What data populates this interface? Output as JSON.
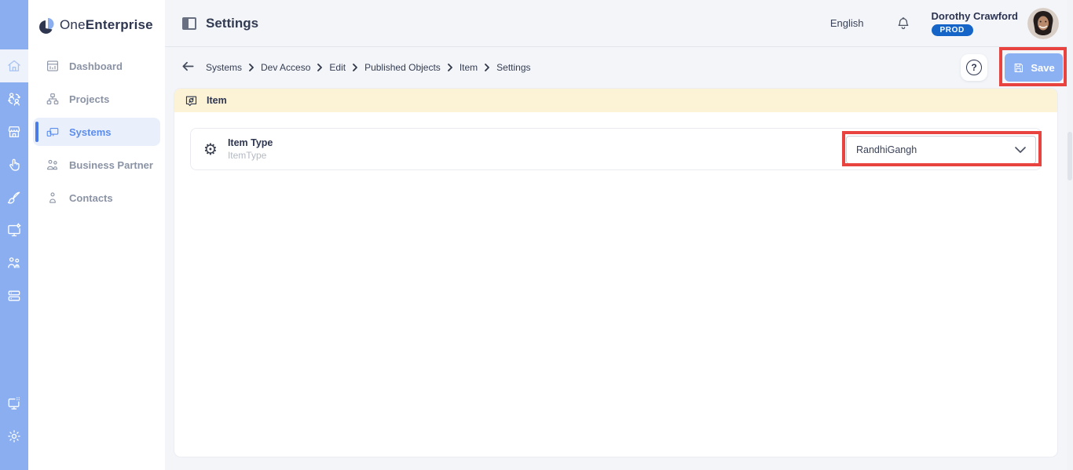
{
  "brand": {
    "name_light": "One",
    "name_bold": "Enterprise"
  },
  "rail": {
    "icons": [
      "home-icon",
      "people-sync-icon",
      "store-icon",
      "hand-pointer-icon",
      "paint-brush-icon",
      "monitor-star-icon",
      "business-partner-icon",
      "server-icon",
      "monitor-apps-icon",
      "settings-gear-icon"
    ],
    "active_icon": "home-icon"
  },
  "sidebar": {
    "items": [
      {
        "label": "Dashboard",
        "icon": "dashboard-icon",
        "active": false
      },
      {
        "label": "Projects",
        "icon": "projects-icon",
        "active": false
      },
      {
        "label": "Systems",
        "icon": "systems-icon",
        "active": true
      },
      {
        "label": "Business Partner",
        "icon": "business-partner-icon",
        "active": false
      },
      {
        "label": "Contacts",
        "icon": "contacts-icon",
        "active": false
      }
    ]
  },
  "topbar": {
    "title": "Settings",
    "language": "English",
    "user": {
      "name": "Dorothy Crawford",
      "badge": "PROD"
    }
  },
  "toolbar": {
    "breadcrumb": [
      "Systems",
      "Dev Acceso",
      "Edit",
      "Published Objects",
      "Item",
      "Settings"
    ],
    "help_label": "?",
    "save_label": "Save"
  },
  "content": {
    "section": {
      "title": "Item",
      "icon": "item-sync-icon"
    },
    "fields": [
      {
        "icon": "gear-icon",
        "label": "Item Type",
        "sublabel": "ItemType",
        "value": "RandhiGangh"
      }
    ]
  },
  "icons": {
    "gear_glyph": "⚙"
  },
  "colors": {
    "rail_blue": "#8aaef0",
    "active_blue": "#5b8def",
    "badge_blue": "#1565c8",
    "banner_yellow": "#fcf3d7",
    "save_blue": "#8cb1f2",
    "annotation_red": "#e8433f"
  }
}
